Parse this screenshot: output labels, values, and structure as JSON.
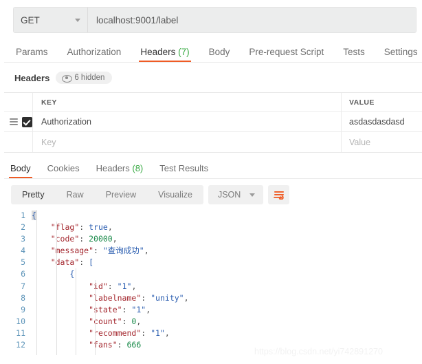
{
  "request": {
    "method": "GET",
    "url": "localhost:9001/label",
    "tabs": [
      {
        "label": "Params",
        "active": false
      },
      {
        "label": "Authorization",
        "active": false
      },
      {
        "label": "Headers",
        "count": "(7)",
        "active": true
      },
      {
        "label": "Body",
        "active": false
      },
      {
        "label": "Pre-request Script",
        "active": false
      },
      {
        "label": "Tests",
        "active": false
      },
      {
        "label": "Settings",
        "active": false
      }
    ]
  },
  "headers_section": {
    "title": "Headers",
    "hidden_badge": "6 hidden",
    "columns": {
      "key": "KEY",
      "value": "VALUE"
    },
    "rows": [
      {
        "key": "Authorization",
        "value": "asdasdasdasd",
        "checked": true
      },
      {
        "key_placeholder": "Key",
        "value_placeholder": "Value",
        "checked": false
      }
    ]
  },
  "response": {
    "tabs": [
      {
        "label": "Body",
        "active": true
      },
      {
        "label": "Cookies",
        "active": false
      },
      {
        "label": "Headers",
        "count": "(8)",
        "active": false
      },
      {
        "label": "Test Results",
        "active": false
      }
    ],
    "view_modes": [
      {
        "label": "Pretty",
        "active": true
      },
      {
        "label": "Raw",
        "active": false
      },
      {
        "label": "Preview",
        "active": false
      },
      {
        "label": "Visualize",
        "active": false
      }
    ],
    "format": "JSON",
    "body_lines": [
      {
        "n": "1",
        "indent": 0,
        "tokens": [
          {
            "t": "{",
            "c": "br cur-brace"
          }
        ]
      },
      {
        "n": "2",
        "indent": 1,
        "tokens": [
          {
            "t": "\"flag\"",
            "c": "k"
          },
          {
            "t": ": ",
            "c": "p"
          },
          {
            "t": "true",
            "c": "b"
          },
          {
            "t": ",",
            "c": "p"
          }
        ]
      },
      {
        "n": "3",
        "indent": 1,
        "tokens": [
          {
            "t": "\"code\"",
            "c": "k"
          },
          {
            "t": ": ",
            "c": "p"
          },
          {
            "t": "20000",
            "c": "n"
          },
          {
            "t": ",",
            "c": "p"
          }
        ]
      },
      {
        "n": "4",
        "indent": 1,
        "tokens": [
          {
            "t": "\"message\"",
            "c": "k"
          },
          {
            "t": ": ",
            "c": "p"
          },
          {
            "t": "\"查询成功\"",
            "c": "s"
          },
          {
            "t": ",",
            "c": "p"
          }
        ]
      },
      {
        "n": "5",
        "indent": 1,
        "tokens": [
          {
            "t": "\"data\"",
            "c": "k"
          },
          {
            "t": ": ",
            "c": "p"
          },
          {
            "t": "[",
            "c": "br"
          }
        ]
      },
      {
        "n": "6",
        "indent": 2,
        "tokens": [
          {
            "t": "{",
            "c": "br"
          }
        ]
      },
      {
        "n": "7",
        "indent": 3,
        "tokens": [
          {
            "t": "\"id\"",
            "c": "k"
          },
          {
            "t": ": ",
            "c": "p"
          },
          {
            "t": "\"1\"",
            "c": "s"
          },
          {
            "t": ",",
            "c": "p"
          }
        ]
      },
      {
        "n": "8",
        "indent": 3,
        "tokens": [
          {
            "t": "\"labelname\"",
            "c": "k"
          },
          {
            "t": ": ",
            "c": "p"
          },
          {
            "t": "\"unity\"",
            "c": "s"
          },
          {
            "t": ",",
            "c": "p"
          }
        ]
      },
      {
        "n": "9",
        "indent": 3,
        "tokens": [
          {
            "t": "\"state\"",
            "c": "k"
          },
          {
            "t": ": ",
            "c": "p"
          },
          {
            "t": "\"1\"",
            "c": "s"
          },
          {
            "t": ",",
            "c": "p"
          }
        ]
      },
      {
        "n": "10",
        "indent": 3,
        "tokens": [
          {
            "t": "\"count\"",
            "c": "k"
          },
          {
            "t": ": ",
            "c": "p"
          },
          {
            "t": "0",
            "c": "n"
          },
          {
            "t": ",",
            "c": "p"
          }
        ]
      },
      {
        "n": "11",
        "indent": 3,
        "tokens": [
          {
            "t": "\"recommend\"",
            "c": "k"
          },
          {
            "t": ": ",
            "c": "p"
          },
          {
            "t": "\"1\"",
            "c": "s"
          },
          {
            "t": ",",
            "c": "p"
          }
        ]
      },
      {
        "n": "12",
        "indent": 3,
        "tokens": [
          {
            "t": "\"fans\"",
            "c": "k"
          },
          {
            "t": ": ",
            "c": "p"
          },
          {
            "t": "666",
            "c": "n"
          }
        ]
      }
    ]
  },
  "watermark": "https://blog.csdn.net/yi742891270",
  "colors": {
    "accent": "#ef5b25",
    "count_green": "#3aab45",
    "toolbar_bg": "#f0f0f0"
  }
}
